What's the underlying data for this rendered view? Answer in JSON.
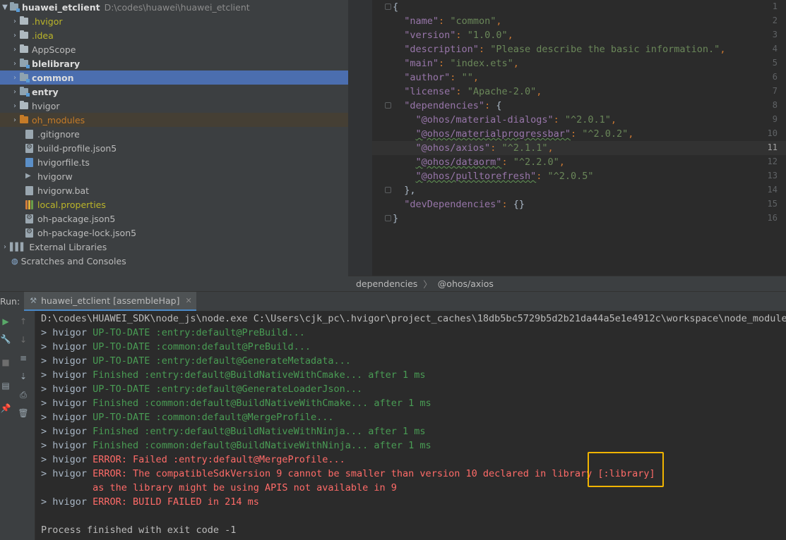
{
  "project": {
    "name": "huawei_etclient",
    "path": "D:\\codes\\huawei\\huawei_etclient",
    "items": [
      {
        "label": ".hvigor",
        "style": "yellow"
      },
      {
        "label": ".idea",
        "style": "yellow"
      },
      {
        "label": "AppScope",
        "style": "normal"
      },
      {
        "label": "blelibrary",
        "style": "bold"
      },
      {
        "label": "common",
        "style": "bold",
        "selected": true
      },
      {
        "label": "entry",
        "style": "bold"
      },
      {
        "label": "hvigor",
        "style": "normal"
      },
      {
        "label": "oh_modules",
        "style": "orange",
        "excluded": true
      }
    ],
    "files": [
      ".gitignore",
      "build-profile.json5",
      "hvigorfile.ts",
      "hvigorw",
      "hvigorw.bat",
      "local.properties",
      "oh-package.json5",
      "oh-package-lock.json5"
    ],
    "external_libraries": "External Libraries",
    "scratches": "Scratches and Consoles"
  },
  "editor": {
    "line_numbers": [
      "1",
      "2",
      "3",
      "4",
      "5",
      "6",
      "7",
      "8",
      "9",
      "10",
      "11",
      "12",
      "13",
      "14",
      "15",
      "16"
    ],
    "current_line": "11",
    "lines": {
      "l1": "{",
      "name_key": "\"name\"",
      "name_val": "\"common\"",
      "version_key": "\"version\"",
      "version_val": "\"1.0.0\"",
      "desc_key": "\"description\"",
      "desc_val": "\"Please describe the basic information.\"",
      "main_key": "\"main\"",
      "main_val": "\"index.ets\"",
      "author_key": "\"author\"",
      "author_val": "\"\"",
      "license_key": "\"license\"",
      "license_val": "\"Apache-2.0\"",
      "deps_key": "\"dependencies\"",
      "d1_key": "\"@ohos/material-dialogs\"",
      "d1_val": "\"^2.0.1\"",
      "d2_key": "\"@ohos/materialprogressbar\"",
      "d2_val": "\"^2.0.2\"",
      "d3_key": "\"@ohos/axios\"",
      "d3_val": "\"^2.1.1\"",
      "d4_key": "\"@ohos/dataorm\"",
      "d4_val": "\"^2.2.0\"",
      "d5_key": "\"@ohos/pulltorefresh\"",
      "d5_val": "\"^2.0.5\"",
      "close_deps": "},",
      "devdeps_key": "\"devDependencies\"",
      "devdeps_val": "{}",
      "l16": "}"
    }
  },
  "breadcrumb": {
    "a": "dependencies",
    "b": "@ohos/axios"
  },
  "run": {
    "label": "Run:",
    "tab": "huawei_etclient [assembleHap]",
    "command": "D:\\codes\\HUAWEI_SDK\\node_js\\node.exe C:\\Users\\cjk_pc\\.hvigor\\project_caches\\18db5bc5729b5d2b21da44a5e1e4912c\\workspace\\node_modules\\",
    "lines": [
      {
        "prefix": "> hvigor ",
        "text": "UP-TO-DATE :entry:default@PreBuild...",
        "color": "green"
      },
      {
        "prefix": "> hvigor ",
        "text": "UP-TO-DATE :common:default@PreBuild...",
        "color": "green"
      },
      {
        "prefix": "> hvigor ",
        "text": "UP-TO-DATE :entry:default@GenerateMetadata...",
        "color": "green"
      },
      {
        "prefix": "> hvigor ",
        "text": "Finished :entry:default@BuildNativeWithCmake... after 1 ms",
        "color": "green"
      },
      {
        "prefix": "> hvigor ",
        "text": "UP-TO-DATE :entry:default@GenerateLoaderJson...",
        "color": "green"
      },
      {
        "prefix": "> hvigor ",
        "text": "Finished :common:default@BuildNativeWithCmake... after 1 ms",
        "color": "green"
      },
      {
        "prefix": "> hvigor ",
        "text": "UP-TO-DATE :common:default@MergeProfile...",
        "color": "green"
      },
      {
        "prefix": "> hvigor ",
        "text": "Finished :entry:default@BuildNativeWithNinja... after 1 ms",
        "color": "green"
      },
      {
        "prefix": "> hvigor ",
        "text": "Finished :common:default@BuildNativeWithNinja... after 1 ms",
        "color": "green"
      },
      {
        "prefix": "> hvigor ",
        "text": "ERROR: Failed :entry:default@MergeProfile...",
        "color": "red"
      },
      {
        "prefix": "> hvigor ",
        "text": "ERROR: The compatibleSdkVersion 9 cannot be smaller than version 10 declared in library [:library]",
        "color": "red"
      },
      {
        "prefix": "",
        "text": "         as the library might be using APIS not available in 9",
        "color": "red"
      },
      {
        "prefix": "> hvigor ",
        "text": "ERROR: BUILD FAILED in 214 ms",
        "color": "red"
      }
    ],
    "exit": "Process finished with exit code -1"
  },
  "colors": {
    "accent": "#4b6eaf",
    "highlight": "#f0b400",
    "error": "#ff6b68",
    "success": "#499c54"
  }
}
